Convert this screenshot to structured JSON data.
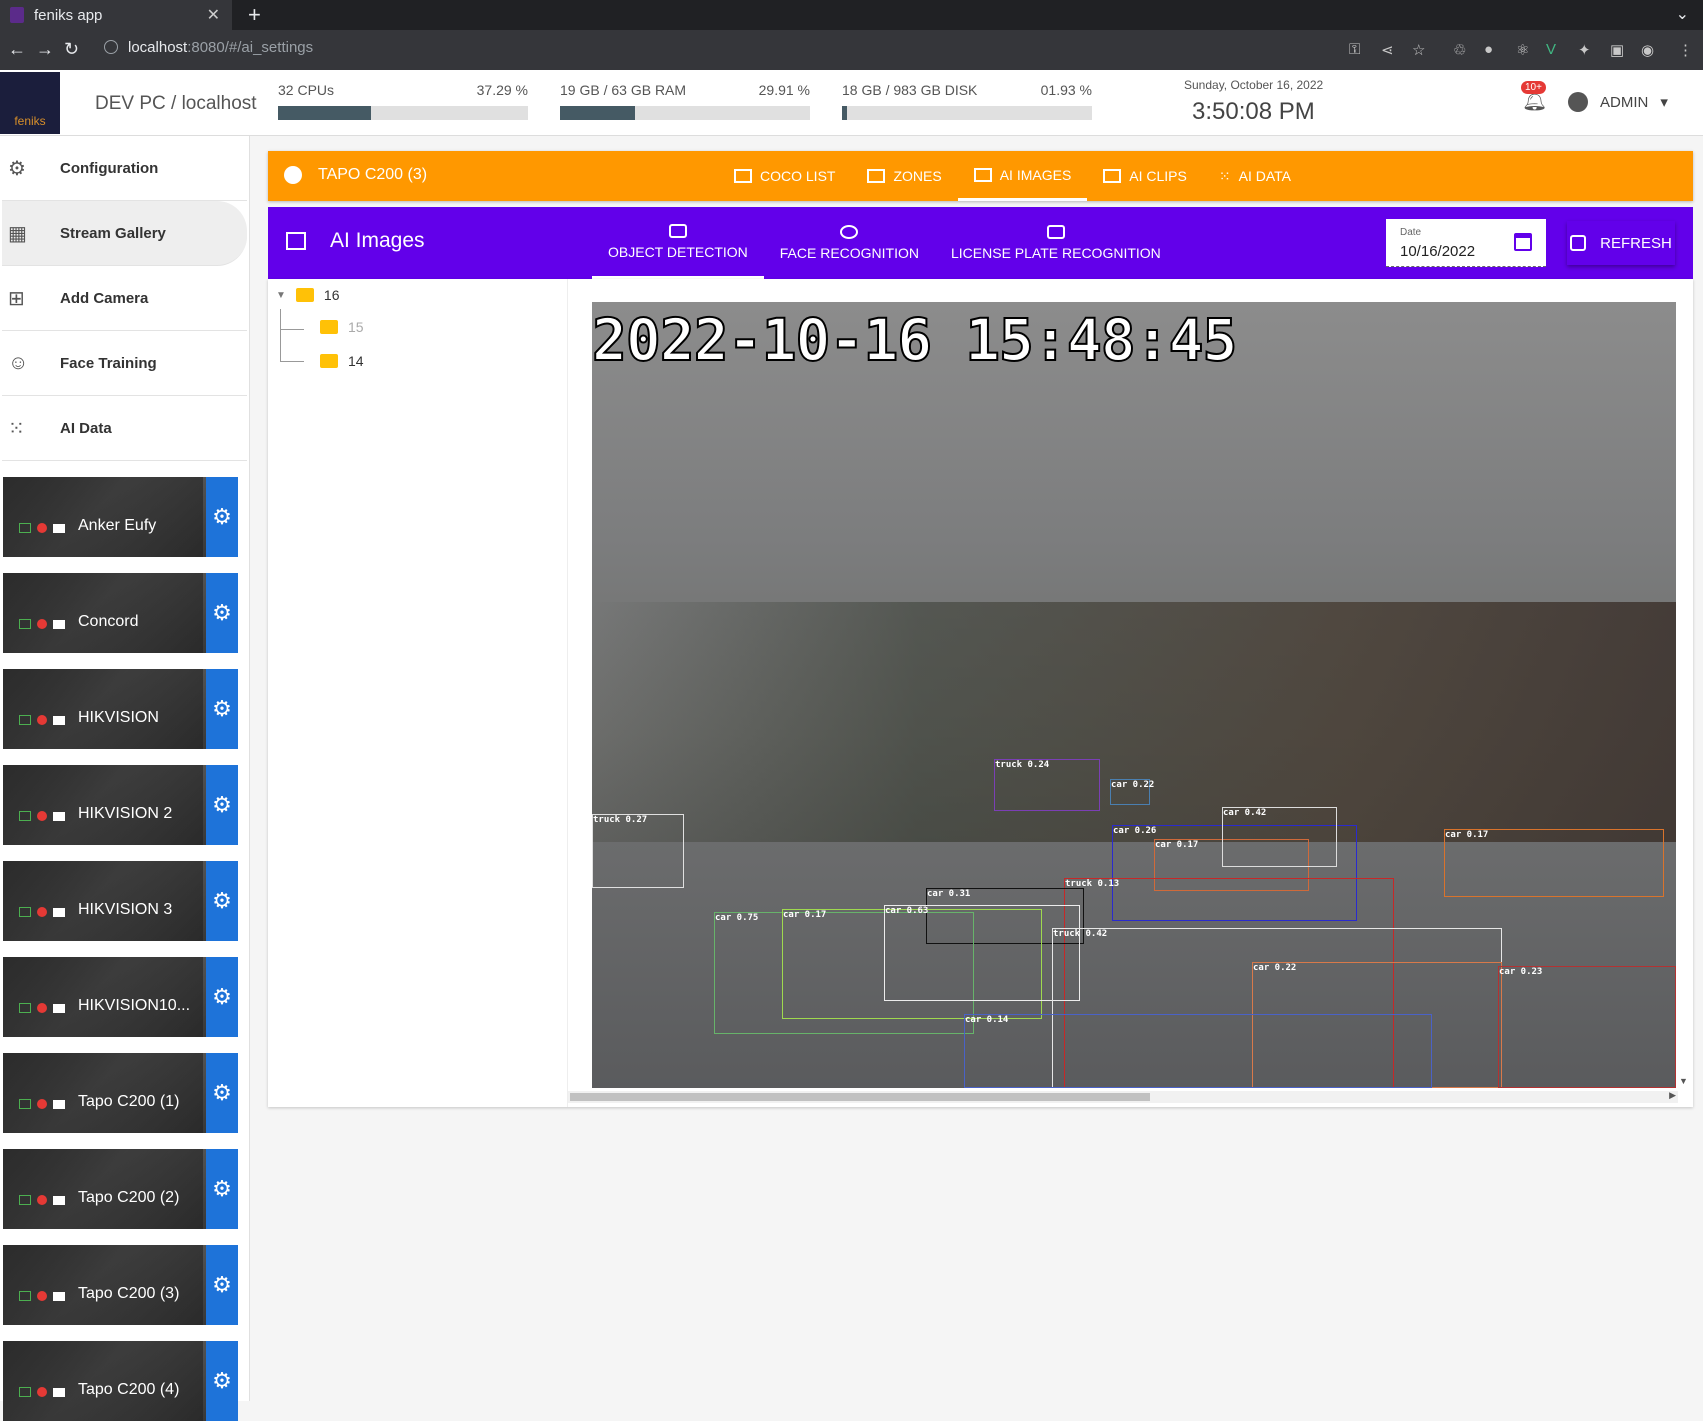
{
  "browser": {
    "tab_title": "feniks app",
    "tab_close": "✕",
    "new_tab": "+",
    "url_host": "localhost",
    "url_rest": ":8080/#/ai_settings"
  },
  "header": {
    "logo_text": "feniks",
    "host": "DEV PC / localhost",
    "cpu": {
      "label": "32 CPUs",
      "percent_text": "37.29 %",
      "fraction": 0.3729
    },
    "ram": {
      "label": "19 GB / 63 GB RAM",
      "percent_text": "29.91 %",
      "fraction": 0.2991
    },
    "disk": {
      "label": "18 GB / 983 GB DISK",
      "percent_text": "01.93 %",
      "fraction": 0.0193
    },
    "date": "Sunday, October 16, 2022",
    "time": "3:50:08 PM",
    "notif_badge": "10+",
    "user": "ADMIN"
  },
  "sidebar": {
    "items": [
      {
        "label": "Configuration",
        "icon": "gear-icon"
      },
      {
        "label": "Stream Gallery",
        "icon": "grid-icon"
      },
      {
        "label": "Add Camera",
        "icon": "add-box-icon"
      },
      {
        "label": "Face Training",
        "icon": "face-icon"
      },
      {
        "label": "AI Data",
        "icon": "dots-grid-icon"
      }
    ],
    "cameras": [
      "Anker Eufy",
      "Concord",
      "HIKVISION",
      "HIKVISION 2",
      "HIKVISION 3",
      "HIKVISION10...",
      "Tapo C200 (1)",
      "Tapo C200 (2)",
      "Tapo C200 (3)",
      "Tapo C200 (4)"
    ]
  },
  "camera_bar": {
    "title": "TAPO C200 (3)",
    "tabs": [
      "COCO LIST",
      "ZONES",
      "AI IMAGES",
      "AI CLIPS",
      "AI DATA"
    ],
    "color": "#ff9800"
  },
  "ai_bar": {
    "title": "AI Images",
    "tabs": [
      "OBJECT DETECTION",
      "FACE RECOGNITION",
      "LICENSE PLATE RECOGNITION"
    ],
    "date_label": "Date",
    "date_value": "10/16/2022",
    "refresh": "REFRESH",
    "color": "#6200ea"
  },
  "tree": {
    "root": "16",
    "children": [
      "15",
      "14"
    ]
  },
  "image": {
    "timestamp": "2022-10-16 15:48:45",
    "detections": [
      "truck 0.24",
      "car 0.22",
      "truck 0.27",
      "car 0.26",
      "car 0.17",
      "car 0.42",
      "car 0.17",
      "truck 0.13",
      "car 0.31",
      "car 0.75",
      "car 0.17",
      "car 0.63",
      "truck 0.42",
      "car 0.22",
      "car 0.23",
      "car 0.14"
    ]
  }
}
